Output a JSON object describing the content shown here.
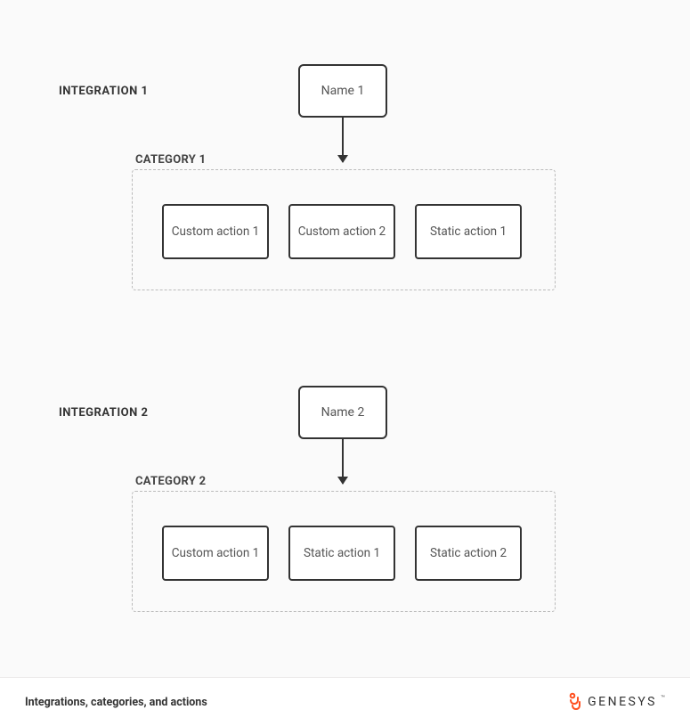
{
  "integrations": [
    {
      "label": "INTEGRATION 1",
      "name_box": "Name 1",
      "category_label": "CATEGORY 1",
      "actions": [
        "Custom action 1",
        "Custom action 2",
        "Static action 1"
      ]
    },
    {
      "label": "INTEGRATION 2",
      "name_box": "Name 2",
      "category_label": "CATEGORY 2",
      "actions": [
        "Custom action 1",
        "Static action 1",
        "Static action 2"
      ]
    }
  ],
  "footer": {
    "caption": "Integrations, categories, and actions",
    "brand": "GENESYS"
  },
  "colors": {
    "accent": "#ff4f1f",
    "box_border": "#333333",
    "dashed_border": "#bbbbbb",
    "bg": "#fafafa"
  }
}
